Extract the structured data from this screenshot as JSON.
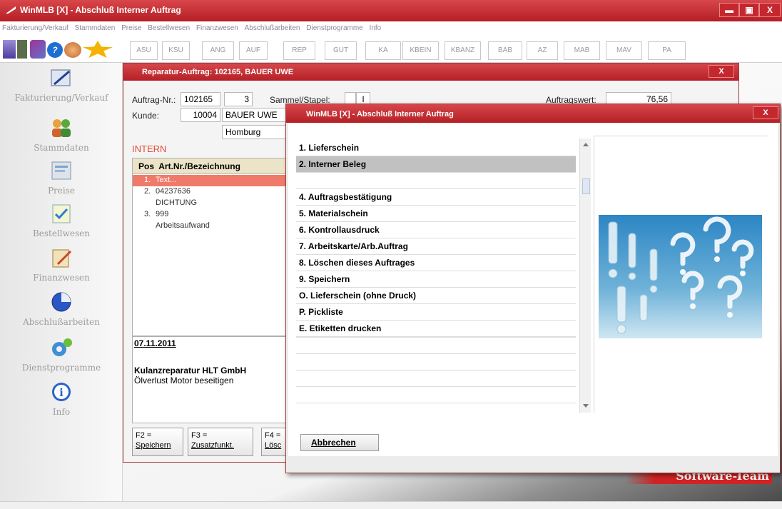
{
  "window": {
    "title": "WinMLB [X] - Abschluß Interner Auftrag",
    "min": "▬",
    "max": "▣",
    "close": "X"
  },
  "menu": [
    "Fakturierung/Verkauf",
    "Stammdaten",
    "Preise",
    "Bestellwesen",
    "Finanzwesen",
    "Abschlußarbeiten",
    "Dienstprogramme",
    "Info"
  ],
  "toolbar": [
    "ASU",
    "KSU",
    "ANG",
    "AUF",
    "REP",
    "GUT",
    "KA",
    "KBEIN",
    "KBANZ",
    "BAB",
    "AZ",
    "MAB",
    "MAV",
    "PA"
  ],
  "sidebar": [
    {
      "label": "Fakturierung/Verkauf",
      "icon": "pen-icon"
    },
    {
      "label": "Stammdaten",
      "icon": "users-icon"
    },
    {
      "label": "Preise",
      "icon": "price-list-icon"
    },
    {
      "label": "Bestellwesen",
      "icon": "order-icon"
    },
    {
      "label": "Finanzwesen",
      "icon": "finance-icon"
    },
    {
      "label": "Abschlußarbeiten",
      "icon": "pie-chart-icon"
    },
    {
      "label": "Dienstprogramme",
      "icon": "gears-icon"
    },
    {
      "label": "Info",
      "icon": "info-icon"
    }
  ],
  "repair": {
    "title": "Reparatur-Auftrag: 102165, BAUER UWE",
    "close": "X",
    "auftrag_label": "Auftrag-Nr.:",
    "auftrag_nr": "102165",
    "auftrag_sub": "3",
    "sammel_label": "Sammel/Stapel:",
    "sammel_value": "I",
    "wert_label": "Auftragswert:",
    "wert_value": "76,56",
    "kunde_label": "Kunde:",
    "kunde_nr": "10004",
    "kunde_name": "BAUER UWE",
    "ort": "Homburg",
    "intern": "INTERN",
    "table_header": "Pos  Art.Nr./Bezeichnung",
    "rows": [
      {
        "pos": "1.",
        "text": "Text..."
      },
      {
        "pos": "2.",
        "text": "04237636"
      },
      {
        "pos": "",
        "text": "DICHTUNG"
      },
      {
        "pos": "3.",
        "text": "999"
      },
      {
        "pos": "",
        "text": "Arbeitsaufwand"
      }
    ],
    "note_date": "07.11.2011",
    "note_company": "Kulanzreparatur HLT GmbH",
    "note_text": "Ölverlust Motor beseitigen",
    "fkeys": [
      {
        "key": "F2 =",
        "label": "Speichern"
      },
      {
        "key": "F3 =",
        "label": "Zusatzfunkt."
      },
      {
        "key": "F4 =",
        "label": "Lösc"
      }
    ]
  },
  "dialog": {
    "title": "WinMLB [X] - Abschluß Interner Auftrag",
    "close": "X",
    "options": [
      "1. Lieferschein",
      "2. Interner Beleg",
      "",
      "4. Auftragsbestätigung",
      "5. Materialschein",
      "6. Kontrollausdruck",
      "7. Arbeitskarte/Arb.Auftrag",
      "8. Löschen dieses Auftrages",
      "9. Speichern",
      "O. Lieferschein (ohne Druck)",
      "P. Pickliste",
      "E. Etiketten drucken"
    ],
    "cancel": "Abbrechen",
    "image_icon": "question-marks-image"
  },
  "brand": "Software-Team",
  "colors": {
    "title_red": "#c42a30",
    "selection": "#c1c1c1",
    "row_highlight": "#f07a6a"
  }
}
